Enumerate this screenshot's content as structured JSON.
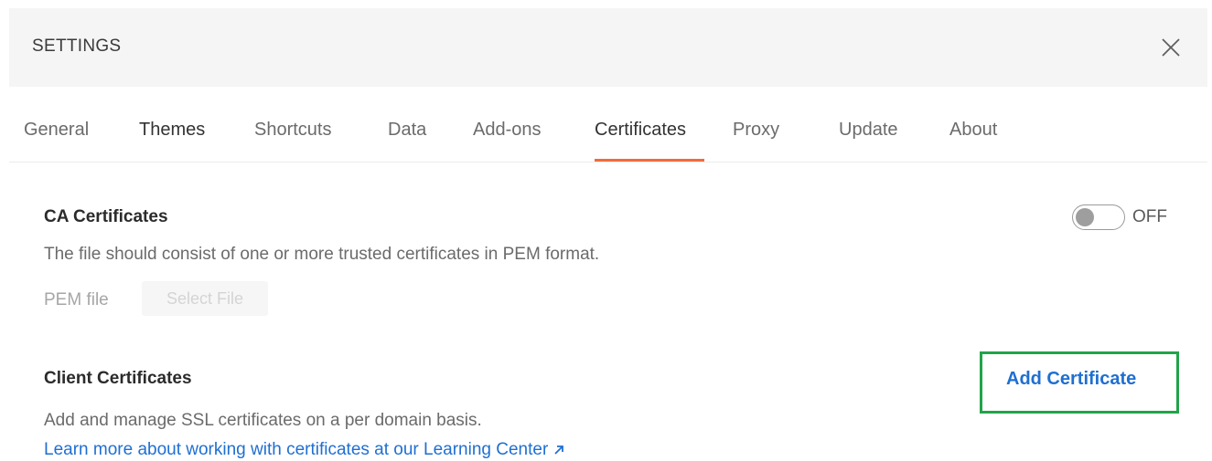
{
  "header": {
    "title": "SETTINGS",
    "close_icon": "close-icon"
  },
  "tabs": [
    {
      "label": "General"
    },
    {
      "label": "Themes"
    },
    {
      "label": "Shortcuts"
    },
    {
      "label": "Data"
    },
    {
      "label": "Add-ons"
    },
    {
      "label": "Certificates",
      "active": true
    },
    {
      "label": "Proxy"
    },
    {
      "label": "Update"
    },
    {
      "label": "About"
    }
  ],
  "ca_certificates": {
    "title": "CA Certificates",
    "description": "The file should consist of one or more trusted certificates in PEM format.",
    "pem_label": "PEM file",
    "select_file_label": "Select File",
    "toggle_state": "OFF"
  },
  "client_certificates": {
    "title": "Client Certificates",
    "add_button_label": "Add Certificate",
    "description": "Add and manage SSL certificates on a per domain basis.",
    "learn_more_link": "Learn more about working with certificates at our Learning Center",
    "learn_more_icon": "external-link-arrow-icon"
  },
  "colors": {
    "accent_tab_underline": "#f26b3a",
    "link": "#1f6fd1",
    "highlight_border": "#22a349"
  }
}
